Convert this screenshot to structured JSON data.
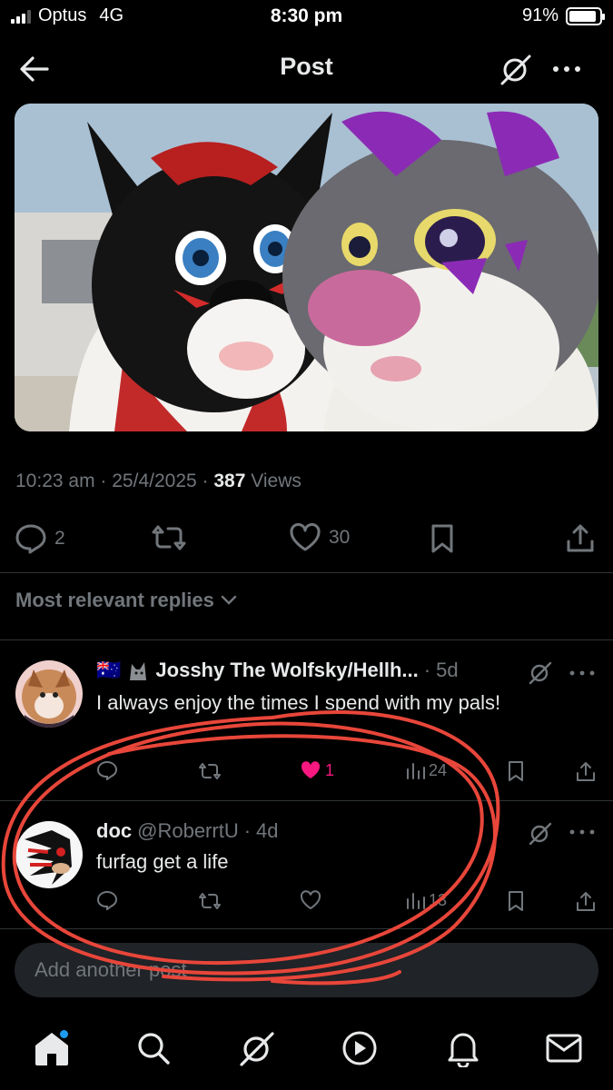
{
  "status": {
    "carrier": "Optus",
    "network": "4G",
    "time": "8:30 pm",
    "battery": "91%",
    "battery_level": 0.91
  },
  "header": {
    "title": "Post",
    "back_icon": "arrow-left-icon",
    "grok_icon": "grok-icon",
    "more_icon": "more-horizontal-icon"
  },
  "post": {
    "time": "10:23 am",
    "date": "25/4/2025",
    "views": "387",
    "views_label": "Views",
    "sep": "·",
    "actions": {
      "replies": "2",
      "likes": "30"
    }
  },
  "replies_header": {
    "label": "Most relevant replies"
  },
  "replies": [
    {
      "flags": "🇦🇺",
      "name": "Josshy The Wolfsky/Hellh...",
      "age": "5d",
      "text": "I always enjoy the times I spend with my pals!",
      "likes": "1",
      "views": "24"
    },
    {
      "name": "doc",
      "handle": "@RoberrtU",
      "age": "4d",
      "text": "furfag get a life",
      "likes": "",
      "views": "13"
    }
  ],
  "composer": {
    "placeholder": "Add another post"
  },
  "colors": {
    "background": "#000000",
    "text": "#e7e9ea",
    "muted": "#71767b",
    "like": "#f91880",
    "annotation": "#e8463a",
    "accent": "#1d9bf0"
  }
}
